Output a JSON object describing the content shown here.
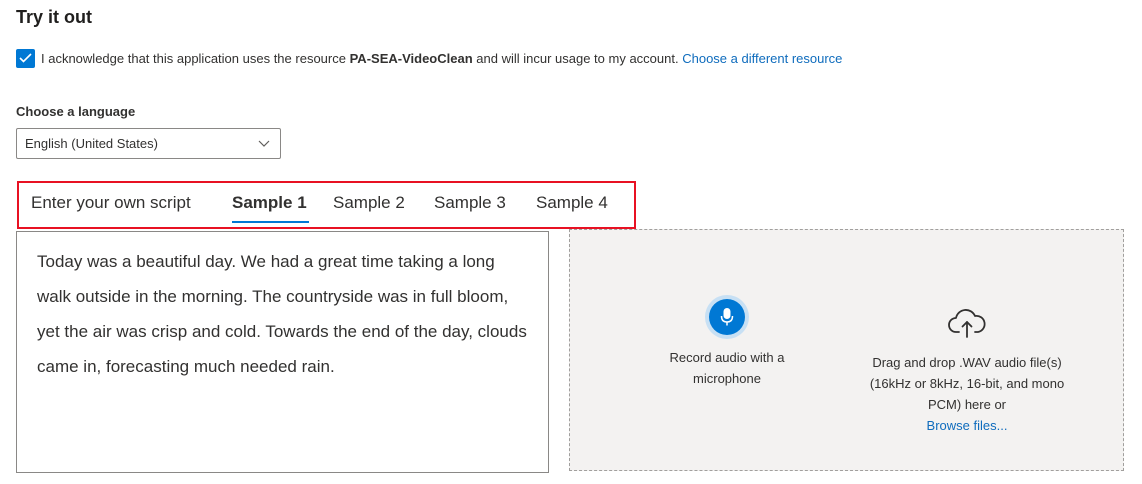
{
  "header": {
    "title": "Try it out"
  },
  "acknowledge": {
    "checked": true,
    "text_prefix": "I acknowledge that this application uses the resource",
    "resource_name": "PA-SEA-VideoClean",
    "text_suffix": "and will incur usage to my account.",
    "change_link": "Choose a different resource"
  },
  "language": {
    "label": "Choose a language",
    "selected": "English (United States)"
  },
  "tabs": [
    {
      "label": "Enter your own script",
      "active": false
    },
    {
      "label": "Sample 1",
      "active": true
    },
    {
      "label": "Sample 2",
      "active": false
    },
    {
      "label": "Sample 3",
      "active": false
    },
    {
      "label": "Sample 4",
      "active": false
    }
  ],
  "script": {
    "text": "Today was a beautiful day. We had a great time taking a long walk outside in the morning. The countryside was in full bloom, yet the air was crisp and cold. Towards the end of the day, clouds came in, forecasting much needed rain."
  },
  "audio": {
    "record_label": "Record audio with a microphone",
    "drop_label": "Drag and drop .WAV audio file(s) (16kHz or 8kHz, 16-bit, and mono PCM) here or",
    "browse_link": "Browse files...",
    "mic_icon": "microphone-icon",
    "upload_icon": "cloud-upload-icon"
  },
  "colors": {
    "accent": "#0078d4",
    "link": "#0f6cbd",
    "highlight_border": "#e81123",
    "panel_bg": "#f3f2f1"
  }
}
